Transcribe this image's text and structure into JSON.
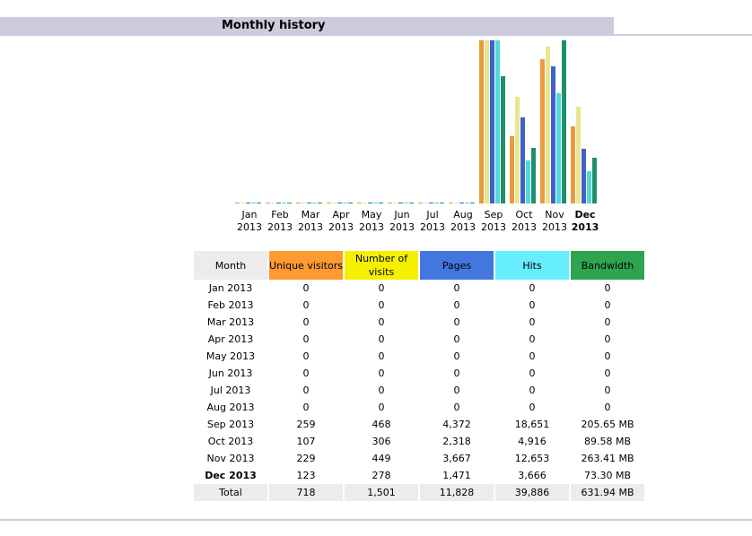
{
  "section": {
    "title": "Monthly history"
  },
  "chart_data": {
    "type": "bar",
    "categories": [
      {
        "month": "Jan",
        "year": "2013"
      },
      {
        "month": "Feb",
        "year": "2013"
      },
      {
        "month": "Mar",
        "year": "2013"
      },
      {
        "month": "Apr",
        "year": "2013"
      },
      {
        "month": "May",
        "year": "2013"
      },
      {
        "month": "Jun",
        "year": "2013"
      },
      {
        "month": "Jul",
        "year": "2013"
      },
      {
        "month": "Aug",
        "year": "2013"
      },
      {
        "month": "Sep",
        "year": "2013"
      },
      {
        "month": "Oct",
        "year": "2013"
      },
      {
        "month": "Nov",
        "year": "2013"
      },
      {
        "month": "Dec",
        "year": "2013"
      }
    ],
    "current_index": 11,
    "series": [
      {
        "name": "Unique visitors",
        "color": "#e89b3c",
        "values": [
          0,
          0,
          0,
          0,
          0,
          0,
          0,
          0,
          259,
          107,
          229,
          123
        ]
      },
      {
        "name": "Number of visits",
        "color": "#ece58f",
        "values": [
          0,
          0,
          0,
          0,
          0,
          0,
          0,
          0,
          468,
          306,
          449,
          278
        ]
      },
      {
        "name": "Pages",
        "color": "#3d62c8",
        "values": [
          0,
          0,
          0,
          0,
          0,
          0,
          0,
          0,
          4372,
          2318,
          3667,
          1471
        ]
      },
      {
        "name": "Hits",
        "color": "#4fd9d9",
        "values": [
          0,
          0,
          0,
          0,
          0,
          0,
          0,
          0,
          18651,
          4916,
          12653,
          3666
        ]
      },
      {
        "name": "Bandwidth",
        "color": "#1f8f6a",
        "values": [
          0,
          0,
          0,
          0,
          0,
          0,
          0,
          0,
          205.65,
          89.58,
          263.41,
          73.3
        ]
      }
    ]
  },
  "table": {
    "headers": {
      "month": "Month",
      "visitors": "Unique visitors",
      "visits": "Number of visits",
      "pages": "Pages",
      "hits": "Hits",
      "bandwidth": "Bandwidth"
    },
    "rows": [
      [
        "Jan 2013",
        "0",
        "0",
        "0",
        "0",
        "0"
      ],
      [
        "Feb 2013",
        "0",
        "0",
        "0",
        "0",
        "0"
      ],
      [
        "Mar 2013",
        "0",
        "0",
        "0",
        "0",
        "0"
      ],
      [
        "Apr 2013",
        "0",
        "0",
        "0",
        "0",
        "0"
      ],
      [
        "May 2013",
        "0",
        "0",
        "0",
        "0",
        "0"
      ],
      [
        "Jun 2013",
        "0",
        "0",
        "0",
        "0",
        "0"
      ],
      [
        "Jul 2013",
        "0",
        "0",
        "0",
        "0",
        "0"
      ],
      [
        "Aug 2013",
        "0",
        "0",
        "0",
        "0",
        "0"
      ],
      [
        "Sep 2013",
        "259",
        "468",
        "4,372",
        "18,651",
        "205.65 MB"
      ],
      [
        "Oct 2013",
        "107",
        "306",
        "2,318",
        "4,916",
        "89.58 MB"
      ],
      [
        "Nov 2013",
        "229",
        "449",
        "3,667",
        "12,653",
        "263.41 MB"
      ],
      [
        "Dec 2013",
        "123",
        "278",
        "1,471",
        "3,666",
        "73.30 MB"
      ]
    ],
    "current_row": 11,
    "total": [
      "Total",
      "718",
      "1,501",
      "11,828",
      "39,886",
      "631.94 MB"
    ]
  }
}
